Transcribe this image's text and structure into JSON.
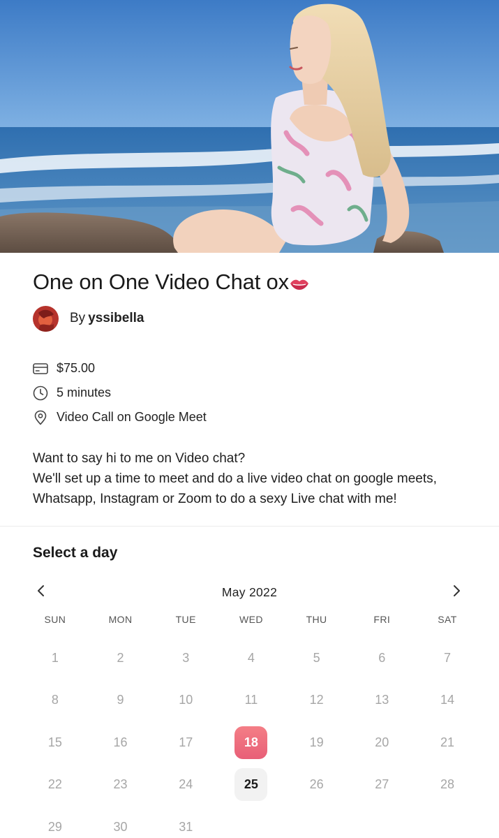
{
  "hero": {
    "icon": "beach-photo"
  },
  "event": {
    "title": "One on One Video Chat ox",
    "title_emoji": "lips-icon",
    "host_prefix": "By",
    "host_name": "yssibella"
  },
  "details": [
    {
      "icon": "credit-card-icon",
      "text": "$75.00"
    },
    {
      "icon": "clock-icon",
      "text": "5 minutes"
    },
    {
      "icon": "location-pin-icon",
      "text": "Video Call on Google Meet"
    }
  ],
  "description": {
    "line1": "Want to say hi to me on Video chat?",
    "line2": "We'll set up a time to meet and do a live video chat on google meets, Whatsapp, Instagram or Zoom to do a sexy Live chat with me!"
  },
  "calendar": {
    "heading": "Select a day",
    "month_label": "May 2022",
    "weekdays": [
      "SUN",
      "MON",
      "TUE",
      "WED",
      "THU",
      "FRI",
      "SAT"
    ],
    "weeks": [
      [
        "1",
        "2",
        "3",
        "4",
        "5",
        "6",
        "7"
      ],
      [
        "8",
        "9",
        "10",
        "11",
        "12",
        "13",
        "14"
      ],
      [
        "15",
        "16",
        "17",
        "18",
        "19",
        "20",
        "21"
      ],
      [
        "22",
        "23",
        "24",
        "25",
        "26",
        "27",
        "28"
      ],
      [
        "29",
        "30",
        "31",
        "",
        "",
        "",
        ""
      ]
    ],
    "selected_day": "18",
    "available_days": [
      "18",
      "25"
    ],
    "accent_color": "#ec6a7c"
  }
}
